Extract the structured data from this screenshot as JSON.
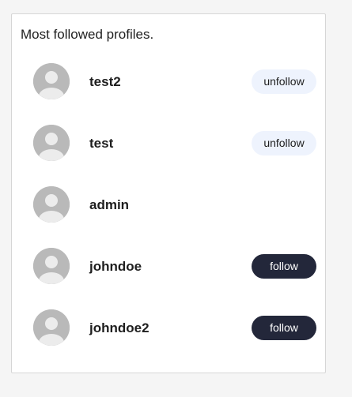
{
  "card": {
    "title": "Most followed profiles."
  },
  "profiles": [
    {
      "username": "test2",
      "action": "unfollow"
    },
    {
      "username": "test",
      "action": "unfollow"
    },
    {
      "username": "admin",
      "action": null
    },
    {
      "username": "johndoe",
      "action": "follow"
    },
    {
      "username": "johndoe2",
      "action": "follow"
    }
  ],
  "colors": {
    "follow_button_bg": "#23273a",
    "unfollow_button_bg": "#eef3fd",
    "avatar_bg": "#b9b9b9"
  },
  "icons": {
    "avatar": "default-user-avatar-icon"
  }
}
